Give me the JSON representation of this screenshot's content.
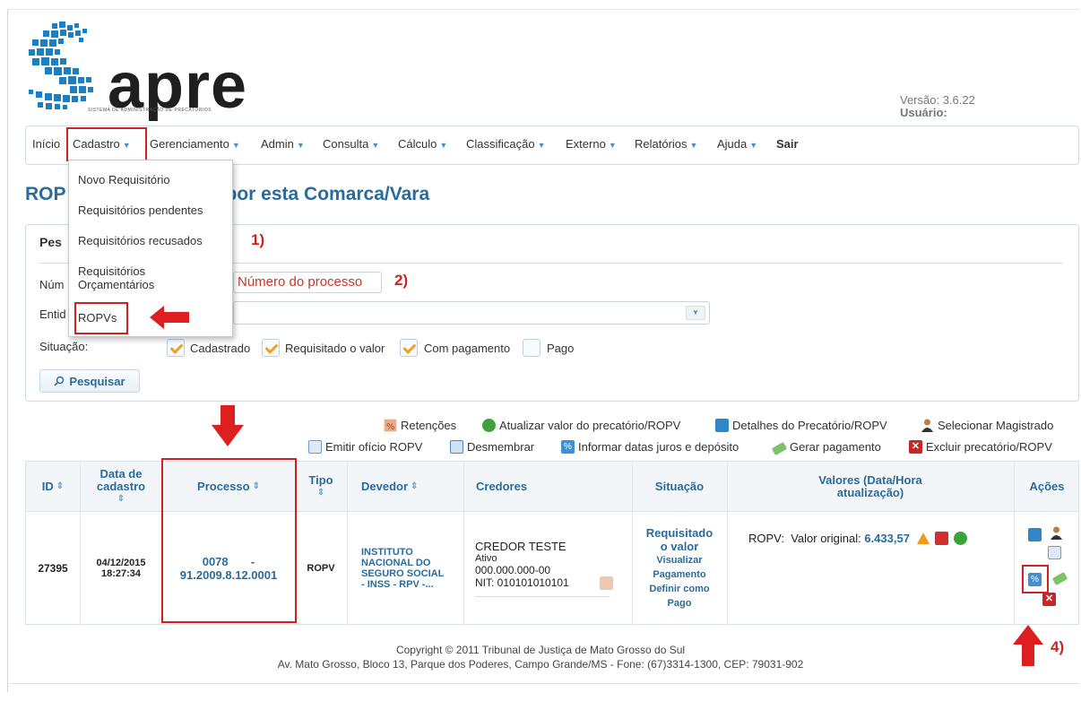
{
  "logo": {
    "word": "apre",
    "subtitle": "SISTEMA DE ADMINISTRAÇÃO DE PRECATÓRIOS"
  },
  "version": {
    "version_text": "Versão: 3.6.22",
    "user_text": "Usuário:"
  },
  "nav": {
    "inicio": "Início",
    "cadastro": "Cadastro",
    "gerenciamento": "Gerenciamento",
    "admin": "Admin",
    "consulta": "Consulta",
    "calculo": "Cálculo",
    "classificacao": "Classificação",
    "externo": "Externo",
    "relatorios": "Relatórios",
    "ajuda": "Ajuda",
    "sair": "Sair"
  },
  "dropdown": {
    "items": [
      "Novo Requisitório",
      "Requisitórios pendentes",
      "Requisitórios recusados",
      "Requisitórios",
      "Orçamentários",
      "ROPVs"
    ]
  },
  "page": {
    "title_prefix": "ROP",
    "title_suffix": "por esta Comarca/Vara"
  },
  "search": {
    "panel_title": "Pes",
    "numero_label": "Núm",
    "processo_placeholder": "Número do processo",
    "entidade_label": "Entid",
    "situacao_label": "Situação:",
    "checks": [
      {
        "label": "Cadastrado",
        "checked": true
      },
      {
        "label": "Requisitado o valor",
        "checked": true
      },
      {
        "label": "Com pagamento",
        "checked": true
      },
      {
        "label": "Pago",
        "checked": false
      }
    ],
    "button": "Pesquisar"
  },
  "annotations": {
    "a1": "1)",
    "a2": "2)",
    "a4": "4)"
  },
  "toolbar": {
    "retencoes": "Retenções",
    "atualizar": "Atualizar valor do precatório/ROPV",
    "detalhes": "Detalhes do Precatório/ROPV",
    "selecionar": "Selecionar Magistrado",
    "emitir": "Emitir ofício ROPV",
    "desmembrar": "Desmembrar",
    "informar": "Informar datas juros e depósito",
    "gerar": "Gerar pagamento",
    "excluir": "Excluir precatório/ROPV"
  },
  "table": {
    "headers": {
      "id": "ID",
      "data1": "Data de",
      "data2": "cadastro",
      "processo": "Processo",
      "tipo": "Tipo",
      "devedor": "Devedor",
      "credores": "Credores",
      "situacao": "Situação",
      "valores1": "Valores (Data/Hora",
      "valores2": "atualização)",
      "acoes": "Ações"
    },
    "row": {
      "id": "27395",
      "data_date": "04/12/2015",
      "data_time": "18:27:34",
      "processo1": "0078       -",
      "processo2": "91.2009.8.12.0001",
      "tipo": "ROPV",
      "devedor1": "INSTITUTO",
      "devedor2": "NACIONAL DO",
      "devedor3": "SEGURO SOCIAL",
      "devedor4": "- INSS - RPV -...",
      "credor_name": "CREDOR TESTE",
      "credor_status": "Ativo",
      "credor_doc": "000.000.000-00",
      "credor_nit": "NIT: 010101010101",
      "sit1": "Requisitado",
      "sit2": "o valor",
      "sit3": "Visualizar",
      "sit4": "Pagamento",
      "sit5": "Definir como",
      "sit6": "Pago",
      "valor_label": "ROPV:  Valor original:",
      "valor": "6.433,57"
    }
  },
  "footer": {
    "line1": "Copyright © 2011 Tribunal de Justiça de Mato Grosso do Sul",
    "line2": "Av. Mato Grosso, Bloco 13, Parque dos Poderes, Campo Grande/MS - Fone: (67)3314-1300, CEP: 79031-902"
  },
  "colors": {
    "accent": "#2a6b9c",
    "highlight": "#cc2222",
    "check": "#f0a020"
  }
}
